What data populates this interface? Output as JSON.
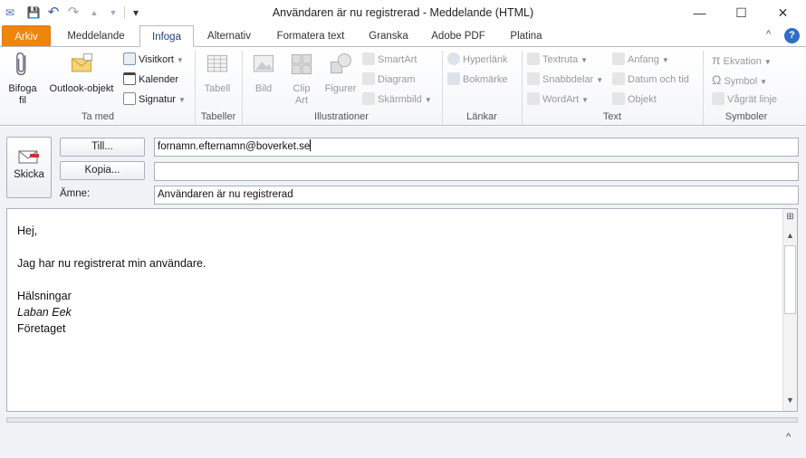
{
  "window": {
    "title": "Användaren är nu registrerad  -  Meddelande (HTML)",
    "controls": {
      "minimize": "—",
      "maximize": "☐",
      "close": "✕"
    }
  },
  "qat": {
    "save": "💾",
    "undo": "↶",
    "redo": "↷",
    "up": "▲",
    "down": "▼",
    "customize": "▾"
  },
  "tabs": [
    "Arkiv",
    "Meddelande",
    "Infoga",
    "Alternativ",
    "Formatera text",
    "Granska",
    "Adobe PDF",
    "Platina"
  ],
  "ribbon": {
    "ta_med": {
      "label": "Ta med",
      "bifoga": "Bifoga fil",
      "outlook_objekt": "Outlook-objekt",
      "visitkort": "Visitkort",
      "kalender": "Kalender",
      "signatur": "Signatur"
    },
    "tabeller": {
      "label": "Tabeller",
      "tabell": "Tabell"
    },
    "illustrationer": {
      "label": "Illustrationer",
      "bild": "Bild",
      "clip_art": "Clip Art",
      "figurer": "Figurer",
      "smartart": "SmartArt",
      "diagram": "Diagram",
      "skarmbild": "Skärmbild"
    },
    "lankar": {
      "label": "Länkar",
      "hyperlank": "Hyperlänk",
      "bokmarke": "Bokmärke"
    },
    "text": {
      "label": "Text",
      "textruta": "Textruta",
      "snabbdelar": "Snabbdelar",
      "wordart": "WordArt",
      "anfang": "Anfang",
      "datum": "Datum och tid",
      "objekt": "Objekt"
    },
    "symboler": {
      "label": "Symboler",
      "ekvation": "Ekvation",
      "symbol": "Symbol",
      "vagratt": "Vågrät linje"
    }
  },
  "compose": {
    "skicka": "Skicka",
    "till_button": "Till...",
    "kopia_button": "Kopia...",
    "amne_label": "Ämne:",
    "till_value": "fornamn.efternamn@boverket.se",
    "kopia_value": "",
    "amne_value": "Användaren är nu registrerad"
  },
  "body": {
    "greeting": "Hej,",
    "message": "Jag har nu registrerat min användare.",
    "closing": "Hälsningar",
    "name": "Laban Eek",
    "company": "Företaget"
  },
  "colors": {
    "arkiv_tab": "#f0850c",
    "accent": "#1e3f7a"
  }
}
